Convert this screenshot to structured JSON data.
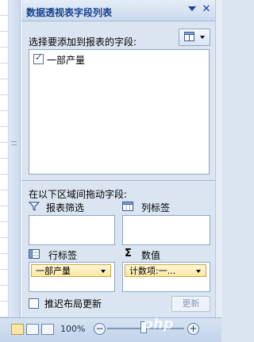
{
  "pane": {
    "title": "数据透视表字段列表",
    "choose_fields_label": "选择要添加到报表的字段:",
    "fields": [
      {
        "label": "一部产量",
        "checked": true
      }
    ],
    "drag_areas_label": "在以下区域间拖动字段:",
    "areas": {
      "report_filter": {
        "label": "报表筛选"
      },
      "column_labels": {
        "label": "列标签"
      },
      "row_labels": {
        "label": "行标签",
        "item": "一部产量"
      },
      "values": {
        "label": "数值",
        "item": "计数项:一..."
      }
    },
    "defer_update_label": "推迟布局更新",
    "update_button": "更新"
  },
  "status": {
    "zoom": "100%",
    "zoom_fraction": 0.5
  },
  "icons": {
    "title_menu": "chevron-down-icon",
    "title_close": "close-icon",
    "layout": "layout-icon",
    "filter": "filter-icon",
    "columns": "column-icon",
    "rows": "row-icon",
    "values": "sigma-icon"
  },
  "watermark": "php"
}
